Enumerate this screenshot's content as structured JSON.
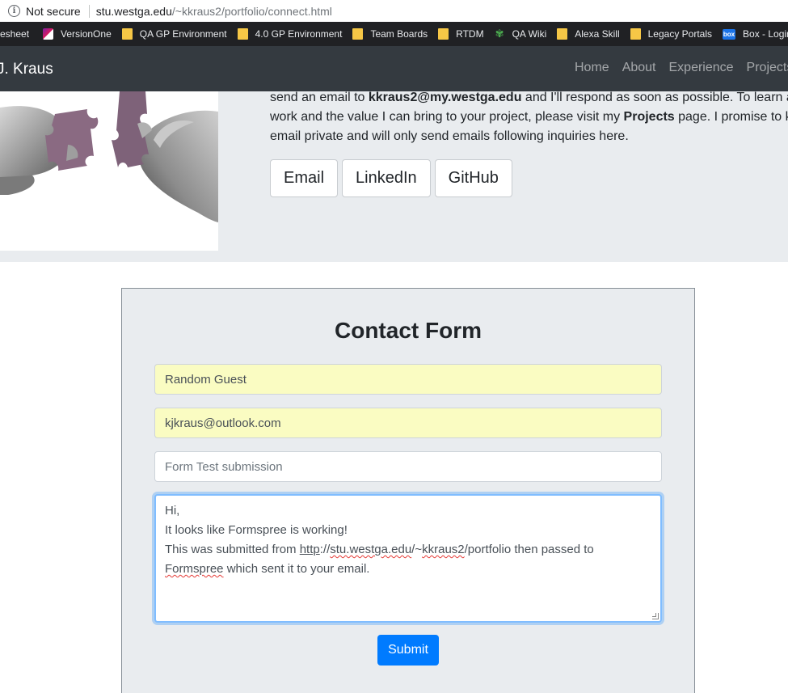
{
  "browser": {
    "security_label": "Not secure",
    "url_host": "stu.westga.edu",
    "url_path": "/~kkraus2/portfolio/connect.html"
  },
  "bookmarks": [
    {
      "label": "esheet",
      "icon": "none"
    },
    {
      "label": "VersionOne",
      "icon": "versionone-icon"
    },
    {
      "label": "QA GP Environment",
      "icon": "folder-icon"
    },
    {
      "label": "4.0 GP Environment",
      "icon": "folder-icon"
    },
    {
      "label": "Team Boards",
      "icon": "folder-icon"
    },
    {
      "label": "RTDM",
      "icon": "folder-icon"
    },
    {
      "label": "QA Wiki",
      "icon": "wiki-icon"
    },
    {
      "label": "Alexa Skill",
      "icon": "folder-icon"
    },
    {
      "label": "Legacy Portals",
      "icon": "folder-icon"
    },
    {
      "label": "Box - Login",
      "icon": "box-icon"
    }
  ],
  "navbar": {
    "brand": "J. Kraus",
    "links": [
      "Home",
      "About",
      "Experience",
      "Projects"
    ]
  },
  "hero": {
    "line1_a": "send an email to ",
    "line1_email": "kkraus2@my.westga.edu",
    "line1_b": " and I'll respond as soon as possible. To learn ab",
    "line2_a": "work and the value I can bring to your project, please visit my ",
    "line2_projects": "Projects",
    "line2_b": " page. I promise to k",
    "line3": "email private and will only send emails following inquiries here.",
    "buttons": {
      "email": "Email",
      "linkedin": "LinkedIn",
      "github": "GitHub"
    }
  },
  "contact_form": {
    "title": "Contact Form",
    "name_value": "Random Guest",
    "email_value": "kjkraus@outlook.com",
    "subject_placeholder": "Form Test submission",
    "message": {
      "line1": "Hi,",
      "line2": "It looks like Formspree is working!",
      "line3_a": "This was submitted from ",
      "line3_http": "http",
      "line3_b": "://",
      "line3_host": "stu.westga.edu",
      "line3_c": "/~",
      "line3_user": "kkraus2",
      "line3_d": "/portfolio then passed to",
      "line4_formspree": "Formspree",
      "line4_b": " which sent it to your email."
    },
    "submit_label": "Submit"
  },
  "colors": {
    "navbar_bg": "#343a40",
    "section_bg": "#e9ecef",
    "primary": "#007bff",
    "autofill": "#fafcc2"
  }
}
